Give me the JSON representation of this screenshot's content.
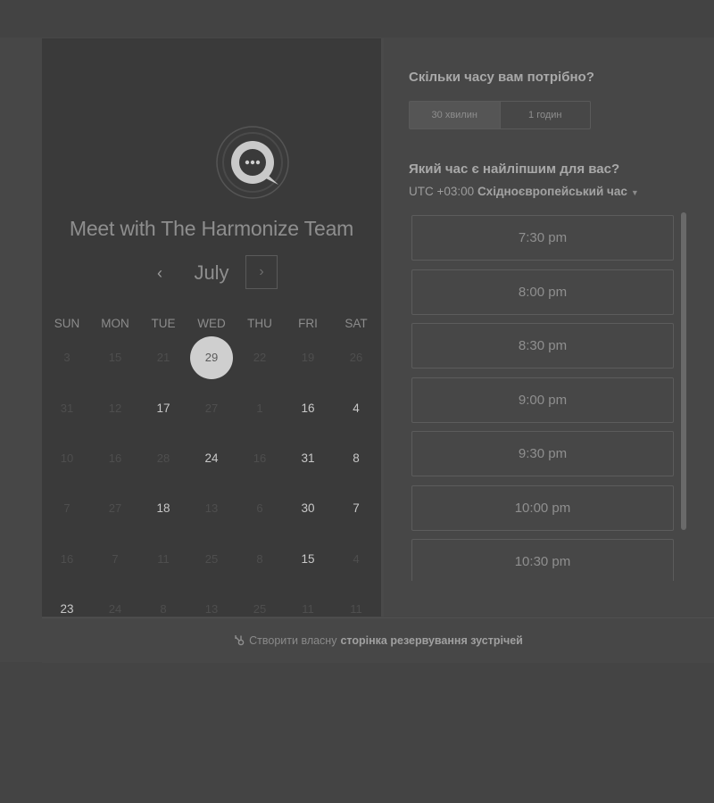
{
  "calendar": {
    "title": "Meet with The Harmonize Team",
    "month": "July",
    "prev_icon": "‹",
    "next_icon": "›",
    "weekdays": [
      "SUN",
      "MON",
      "TUE",
      "WED",
      "THU",
      "FRI",
      "SAT"
    ],
    "weeks": [
      [
        "3",
        "15",
        "21",
        "29",
        "22",
        "19",
        "26"
      ],
      [
        "31",
        "12",
        "17",
        "27",
        "1",
        "16",
        "4"
      ],
      [
        "10",
        "16",
        "28",
        "24",
        "16",
        "31",
        "8"
      ],
      [
        "7",
        "27",
        "18",
        "13",
        "6",
        "30",
        "7"
      ],
      [
        "16",
        "7",
        "11",
        "25",
        "8",
        "15",
        "4"
      ],
      [
        "23",
        "24",
        "8",
        "13",
        "25",
        "11",
        "11"
      ]
    ],
    "available": [
      [
        false,
        false,
        false,
        false,
        false,
        false,
        false
      ],
      [
        false,
        false,
        true,
        false,
        false,
        true,
        true
      ],
      [
        false,
        false,
        false,
        true,
        false,
        true,
        true
      ],
      [
        false,
        false,
        true,
        false,
        false,
        true,
        true
      ],
      [
        false,
        false,
        false,
        false,
        false,
        true,
        false
      ],
      [
        true,
        false,
        false,
        false,
        false,
        false,
        false
      ]
    ],
    "selected": {
      "week": 0,
      "day": 3
    }
  },
  "booking": {
    "duration_question": "Скільки часу вам потрібно?",
    "durations": [
      "30 хвилин",
      "1 годин"
    ],
    "time_question": "Який час є найліпшим для вас?",
    "timezone_offset": "UTC +03:00",
    "timezone_name": "Східноєвропейський час",
    "slots": [
      "7:30 pm",
      "8:00 pm",
      "8:30 pm",
      "9:00 pm",
      "9:30 pm",
      "10:00 pm",
      "10:30 pm"
    ]
  },
  "footer": {
    "text": "Створити власну",
    "link": "сторінка резервування зустрічей"
  },
  "colors": {
    "background": "#444444",
    "calendar_panel": "#3a3a3a",
    "selected_day": "#cfcfcf"
  }
}
